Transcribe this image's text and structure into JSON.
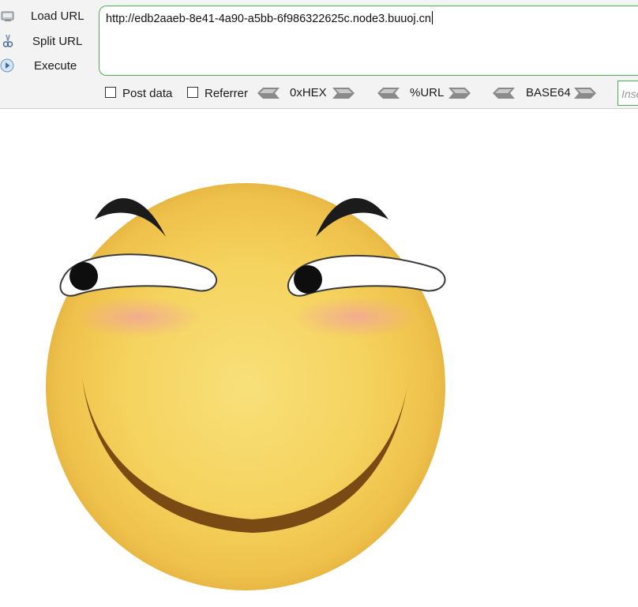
{
  "toolbar": {
    "load_url": "Load URL",
    "split_url": "Split URL",
    "execute": "Execute",
    "url_value": "http://edb2aaeb-8e41-4a90-a5bb-6f986322625c.node3.buuoj.cn"
  },
  "options": {
    "post_data": "Post data",
    "referrer": "Referrer",
    "hex": "0xHEX",
    "url_enc": "%URL",
    "base64": "BASE64",
    "insert_placeholder": "Insert"
  },
  "icons": {
    "load": "monitor-icon",
    "split": "scissors-icon",
    "execute": "play-icon",
    "arrow_left": "arrow-left-icon",
    "arrow_right": "arrow-right-icon"
  },
  "colors": {
    "accent_border": "#4caf50",
    "toolbar_bg": "#f3f3f3",
    "face_yellow": "#f2c94c"
  },
  "content": {
    "image": "smiling-emoji-face"
  }
}
